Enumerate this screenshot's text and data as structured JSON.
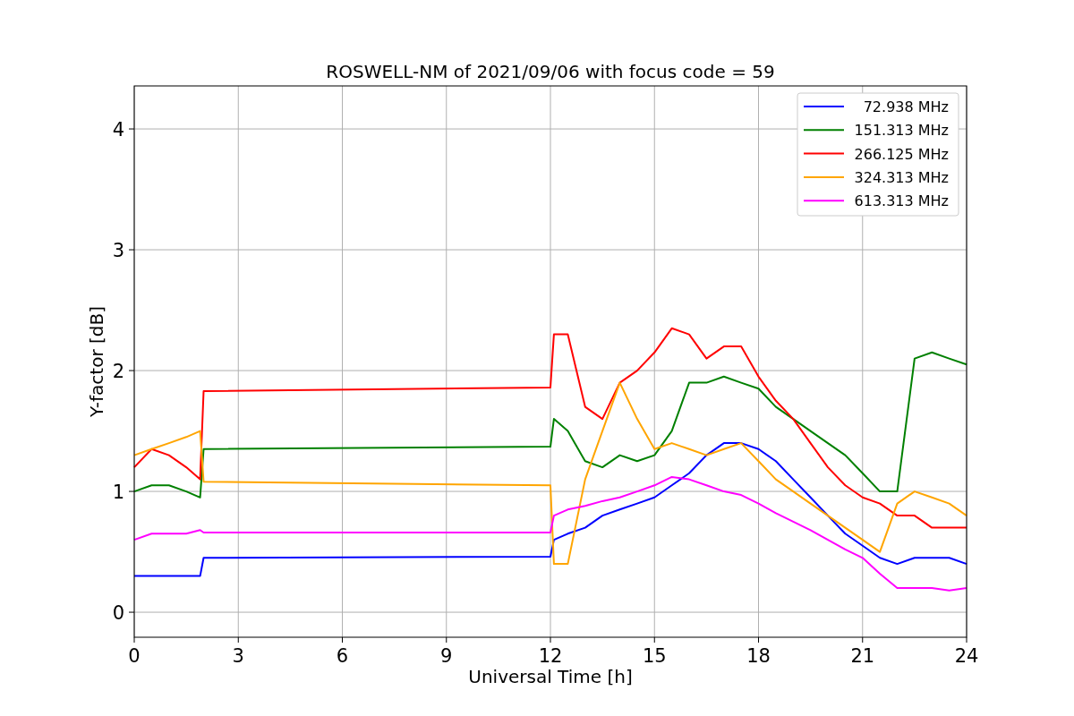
{
  "figure": {
    "chart_data": {
      "type": "line",
      "title": "ROSWELL-NM of 2021/09/06 with focus code = 59",
      "xlabel": "Universal Time [h]",
      "ylabel": "Y-factor [dB]",
      "x": [
        0,
        0.5,
        1,
        1.5,
        1.9,
        2,
        12,
        12.1,
        12.5,
        13,
        13.5,
        14,
        14.5,
        15,
        15.5,
        16,
        16.5,
        17,
        17.5,
        18,
        18.5,
        19,
        19.5,
        20,
        20.5,
        21,
        21.5,
        22,
        22.5,
        23,
        23.5,
        24
      ],
      "series": [
        {
          "name": "72.938 MHz",
          "color": "#0000ff",
          "values": [
            0.3,
            0.3,
            0.3,
            0.3,
            0.3,
            0.45,
            0.46,
            0.6,
            0.65,
            0.7,
            0.8,
            0.85,
            0.9,
            0.95,
            1.05,
            1.15,
            1.3,
            1.4,
            1.4,
            1.35,
            1.25,
            1.1,
            0.95,
            0.8,
            0.65,
            0.55,
            0.45,
            0.4,
            0.45,
            0.45,
            0.45,
            0.4
          ]
        },
        {
          "name": "151.313 MHz",
          "color": "#008000",
          "values": [
            1.0,
            1.05,
            1.05,
            1.0,
            0.95,
            1.35,
            1.37,
            1.6,
            1.5,
            1.25,
            1.2,
            1.3,
            1.25,
            1.3,
            1.5,
            1.9,
            1.9,
            1.95,
            1.9,
            1.85,
            1.7,
            1.6,
            1.5,
            1.4,
            1.3,
            1.15,
            1.0,
            1.0,
            2.1,
            2.15,
            2.1,
            2.05
          ]
        },
        {
          "name": "266.125 MHz",
          "color": "#ff0000",
          "values": [
            1.2,
            1.35,
            1.3,
            1.2,
            1.1,
            1.83,
            1.86,
            2.3,
            2.3,
            1.7,
            1.6,
            1.9,
            2.0,
            2.15,
            2.35,
            2.3,
            2.1,
            2.2,
            2.2,
            1.95,
            1.75,
            1.6,
            1.4,
            1.2,
            1.05,
            0.95,
            0.9,
            0.8,
            0.8,
            0.7,
            0.7,
            0.7
          ]
        },
        {
          "name": "324.313 MHz",
          "color": "#ffa500",
          "values": [
            1.3,
            1.35,
            1.4,
            1.45,
            1.5,
            1.08,
            1.05,
            0.4,
            0.4,
            1.1,
            1.5,
            1.9,
            1.6,
            1.35,
            1.4,
            1.35,
            1.3,
            1.35,
            1.4,
            1.25,
            1.1,
            1.0,
            0.9,
            0.8,
            0.7,
            0.6,
            0.5,
            0.9,
            1.0,
            0.95,
            0.9,
            0.8
          ]
        },
        {
          "name": "613.313 MHz",
          "color": "#ff00ff",
          "values": [
            0.6,
            0.65,
            0.65,
            0.65,
            0.68,
            0.66,
            0.66,
            0.8,
            0.85,
            0.88,
            0.92,
            0.95,
            1.0,
            1.05,
            1.12,
            1.1,
            1.05,
            1.0,
            0.97,
            0.9,
            0.82,
            0.75,
            0.68,
            0.6,
            0.52,
            0.45,
            0.32,
            0.2,
            0.2,
            0.2,
            0.18,
            0.2
          ]
        }
      ],
      "xlim": [
        0,
        24
      ],
      "ylim": [
        -0.207,
        4.356
      ],
      "xticks": [
        0,
        3,
        6,
        9,
        12,
        15,
        18,
        21,
        24
      ],
      "yticks": [
        0,
        1,
        2,
        3,
        4
      ],
      "grid": true,
      "legend": true
    }
  }
}
